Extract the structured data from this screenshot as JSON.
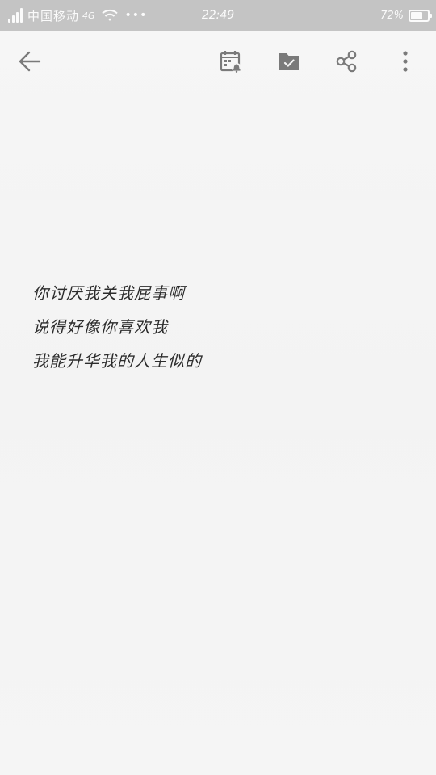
{
  "status_bar": {
    "carrier": "中国移动",
    "network": "4G",
    "more_indicator": "•••",
    "time": "22:49",
    "battery_percent_text": "72%",
    "battery_level": 0.72,
    "signal_bars": 4
  },
  "toolbar": {
    "back": {
      "icon": "back-arrow-icon"
    },
    "reminder": {
      "icon": "calendar-reminder-icon"
    },
    "done": {
      "icon": "checked-folder-icon"
    },
    "share": {
      "icon": "share-icon"
    },
    "more": {
      "icon": "more-vertical-icon"
    }
  },
  "note": {
    "lines": [
      "你讨厌我关我屁事啊",
      "说得好像你喜欢我",
      "我能升华我的人生似的"
    ]
  },
  "colors": {
    "status_bar_bg": "#c4c4c4",
    "page_bg": "#f4f4f4",
    "icon_gray": "#7a7a7a",
    "text": "#2c2c2c"
  }
}
